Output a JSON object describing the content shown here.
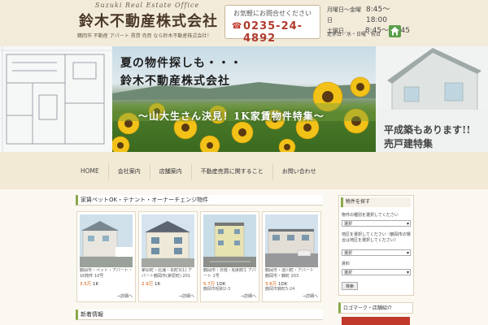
{
  "header": {
    "logo_en": "Suzuki Real Estate Office",
    "logo_name": "鈴木不動産株式会社",
    "logo_sub": "鶴岡市 不動産 アパート 賃貸 売買 なら鈴木不動産株式会社！",
    "contact_label": "お気軽にお問合せください",
    "phone": "0235-24-4892",
    "hours": [
      {
        "days": "月曜日～金曜日",
        "time": "8:45～18:00"
      },
      {
        "days": "土曜日",
        "time": "8:45～16:45"
      }
    ],
    "closed": "定休日／水・日曜・祝日"
  },
  "banner": {
    "headline1": "夏の物件探しも・・・",
    "headline2": "鈴木不動産株式会社",
    "special": "～山大生さん決見！1K家賃物件特集～",
    "right_line1": "平成築もあります!!",
    "right_line2": "売戸建特集"
  },
  "nav": {
    "items": [
      "HOME",
      "会社案内",
      "店舗案内",
      "不動産売買に関すること",
      "お問い合わせ"
    ]
  },
  "main": {
    "heading": "家賃ペットOK・テナント・オーナーチェンジ物件",
    "cards": [
      {
        "title": "鶴岡市・ペット・アパート・1K物件 10号",
        "price": "3.5万",
        "layout": "1K",
        "area": "",
        "more": "→詳細へ"
      },
      {
        "title": "茅原町・北浦・本町3(1) アパート鶴岡市(茅原町) 201",
        "price": "2.9万",
        "layout": "1K",
        "area": "",
        "more": "→詳細へ"
      },
      {
        "title": "鶴岡市・日枝・昭和町1 アパート 1号",
        "price": "5.7万",
        "layout": "1DK",
        "area": "鶴岡市昭和2-3",
        "more": "→詳細へ"
      },
      {
        "title": "鶴岡市・淀川町・アパート 鶴岡市・錦町 203",
        "price": "3.6万",
        "layout": "1DK",
        "area": "鶴岡市錦町5-24",
        "more": "→詳細へ"
      }
    ],
    "news_heading": "新着情報"
  },
  "sidebar": {
    "search_title": "物件を探す",
    "fields": [
      {
        "label": "物件の種別を選択してください",
        "value": "選択"
      },
      {
        "label": "地区を選択してください（鶴岡市の場合は地区を選択してください）",
        "value": "選択"
      },
      {
        "label": "賃料",
        "value": "選択"
      }
    ],
    "search_button": "検索",
    "second_title": "ロゴマーク・店舗紹介"
  },
  "colors": {
    "accent_green": "#8aa84a",
    "phone_red": "#b03a2e",
    "price_orange": "#d35400"
  }
}
